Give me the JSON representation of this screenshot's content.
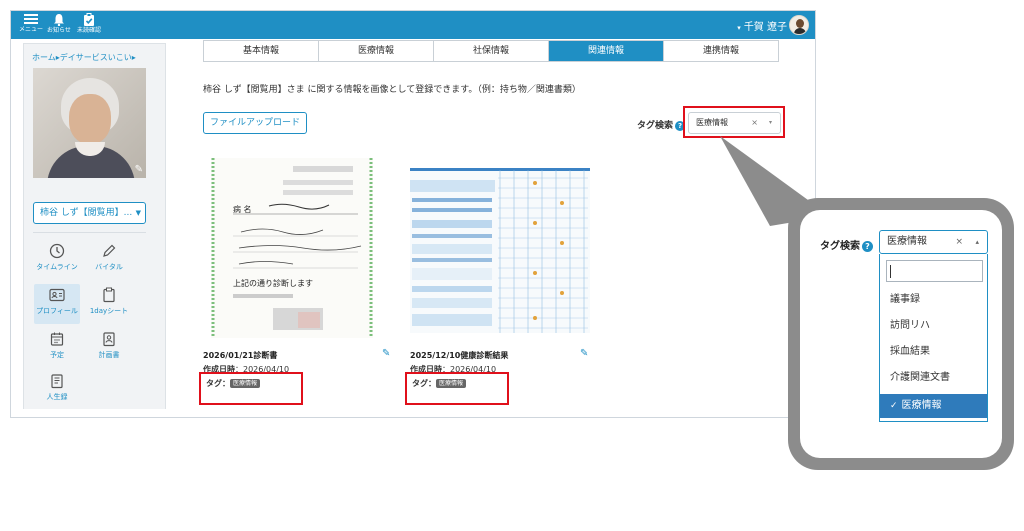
{
  "topbar": {
    "menu_label": "メニュー",
    "notice_label": "お知らせ",
    "unread_label": "未読確認",
    "user_name": "千賀 遼子",
    "user_caret": "▾"
  },
  "sidebar": {
    "breadcrumb": "ホーム▸デイサービスいこい▸",
    "patient_select": "柿谷 しず【閲覧用】...",
    "nav": [
      {
        "label": "タイムライン",
        "icon": "clock-icon"
      },
      {
        "label": "バイタル",
        "icon": "pen-icon"
      },
      {
        "label": "プロフィール",
        "icon": "id-card-icon"
      },
      {
        "label": "1dayシート",
        "icon": "clipboard-icon"
      },
      {
        "label": "予定",
        "icon": "calendar-icon"
      },
      {
        "label": "計画書",
        "icon": "document-person-icon"
      },
      {
        "label": "人生録",
        "icon": "notebook-icon"
      }
    ]
  },
  "tabs": [
    {
      "label": "基本情報",
      "active": false
    },
    {
      "label": "医療情報",
      "active": false
    },
    {
      "label": "社保情報",
      "active": false
    },
    {
      "label": "関連情報",
      "active": true
    },
    {
      "label": "連携情報",
      "active": false
    }
  ],
  "main": {
    "description": "柿谷 しず【閲覧用】さま に関する情報を画像として登録できます。（例：持ち物／関連書類）",
    "upload_label": "ファイルアップロード",
    "tag_search_label": "タグ検索",
    "tag_search_help": "?",
    "tag_selected": "医療情報",
    "tag_clear": "×",
    "tag_arrow": "▾"
  },
  "cards": [
    {
      "title": "2026/01/21診断書",
      "date_label": "作成日時",
      "date_value": "：2026/04/10",
      "tag_label": "タグ：",
      "tag": "医療情報"
    },
    {
      "title": "2025/12/10健康診断結果",
      "date_label": "作成日時",
      "date_value": "：2026/04/10",
      "tag_label": "タグ：",
      "tag": "医療情報"
    }
  ],
  "callout": {
    "label": "タグ検索",
    "help": "?",
    "selected": "医療情報",
    "clear": "×",
    "arrow": "▴",
    "options": [
      {
        "label": "議事録",
        "selected": false
      },
      {
        "label": "訪問リハ",
        "selected": false
      },
      {
        "label": "採血結果",
        "selected": false
      },
      {
        "label": "介護関連文書",
        "selected": false
      },
      {
        "label": "医療情報",
        "selected": true
      }
    ],
    "check": "✓"
  },
  "colors": {
    "accent": "#1f8fc4",
    "highlight": "#e0101b",
    "selected_option": "#2f7bbb"
  }
}
